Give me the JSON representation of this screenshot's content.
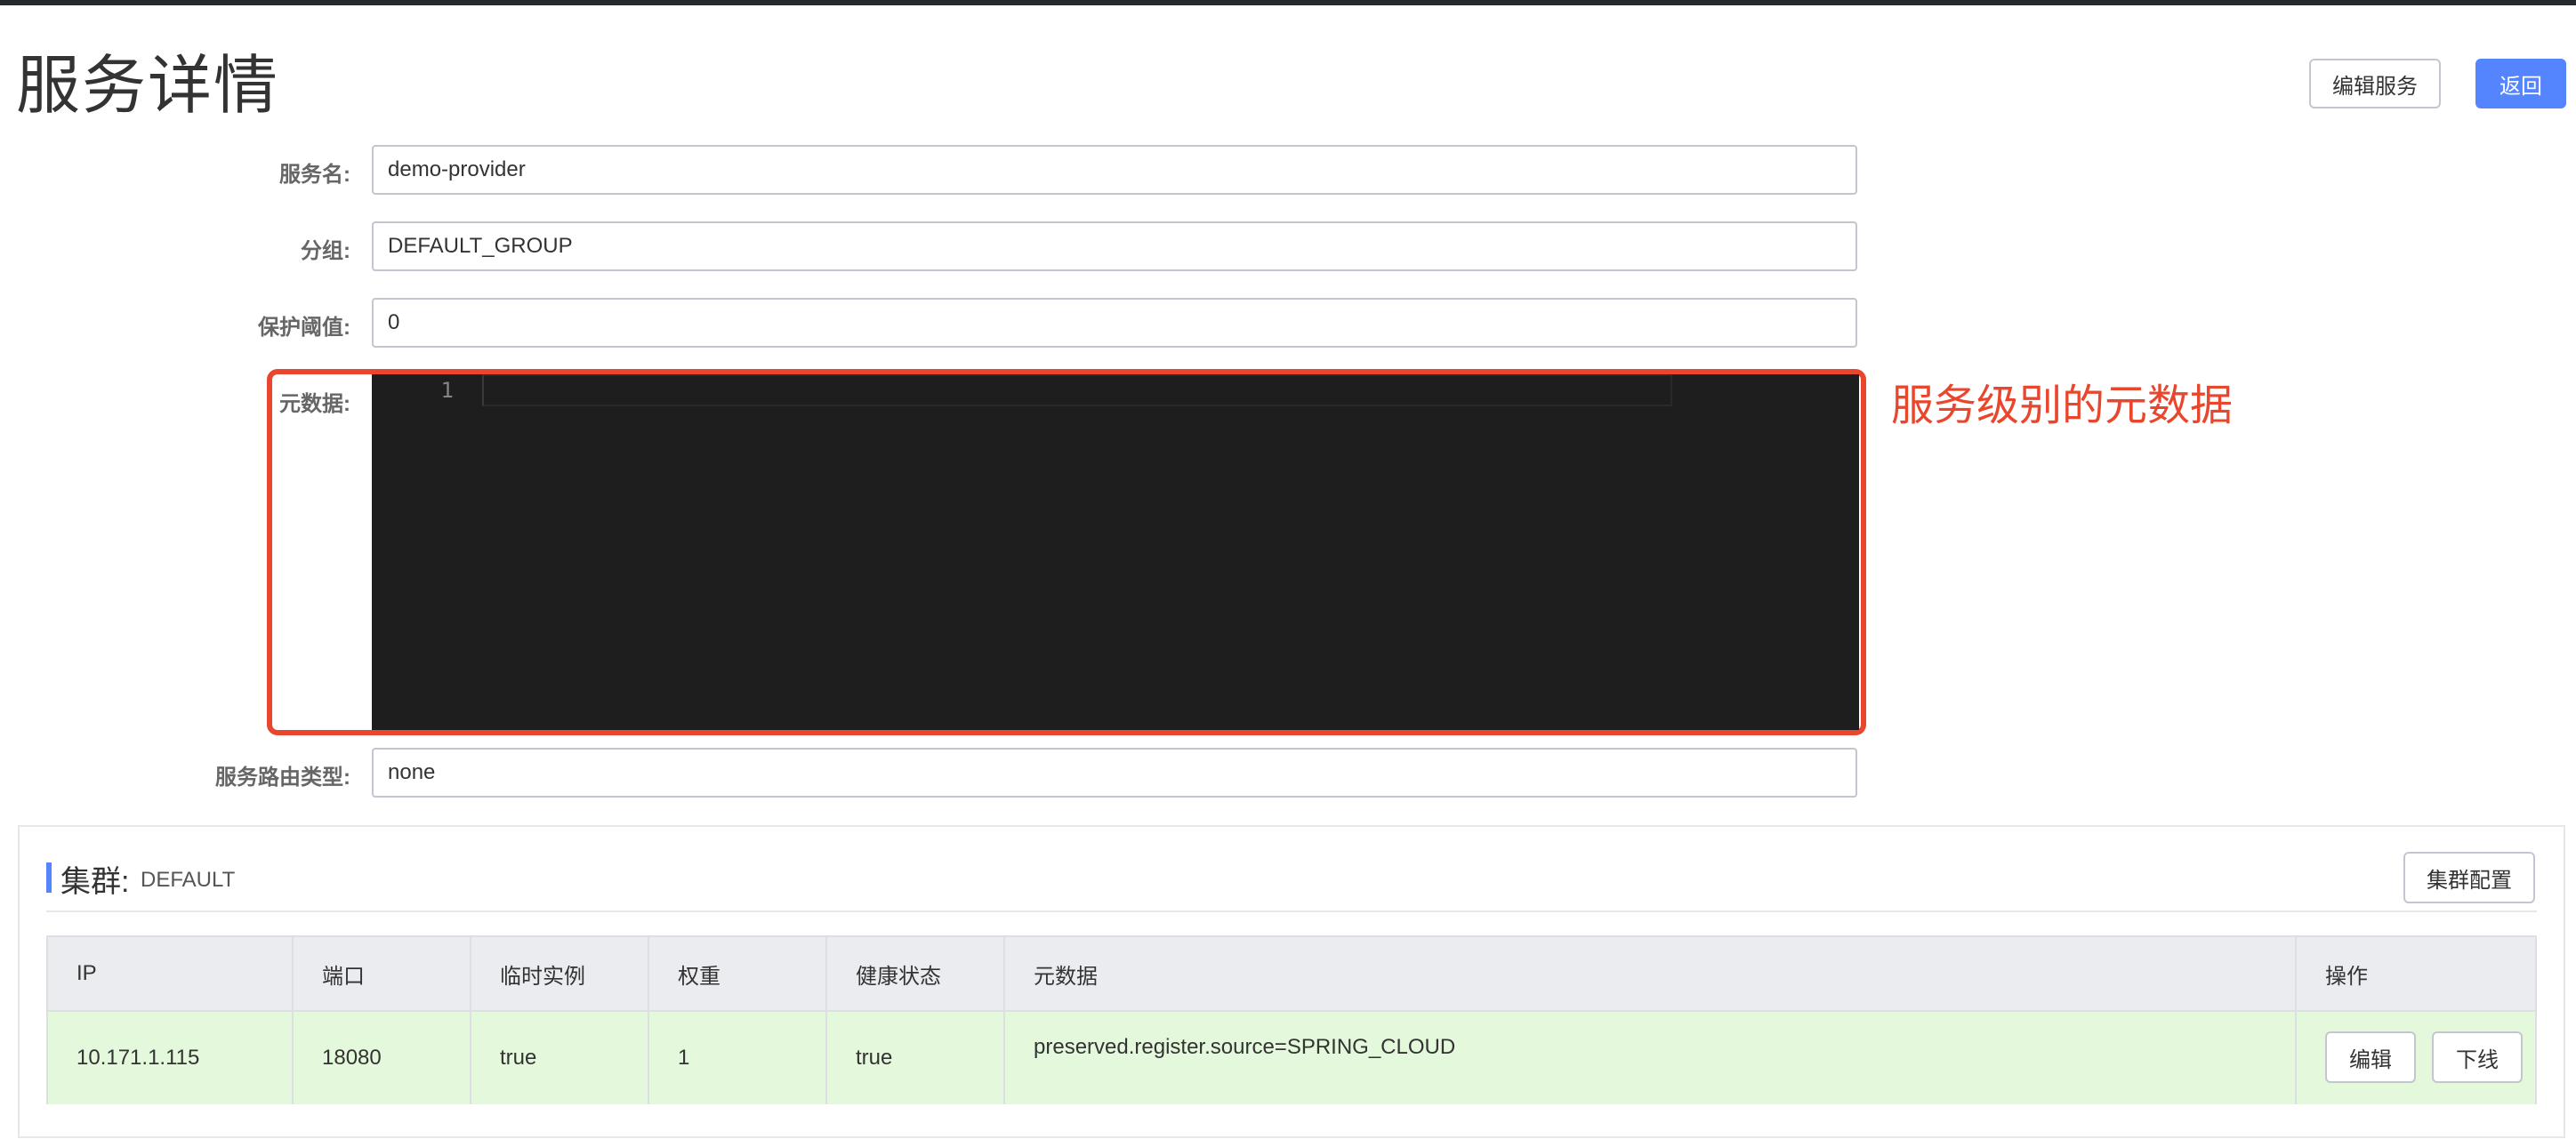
{
  "page": {
    "title": "服务详情",
    "edit_service_label": "编辑服务",
    "back_label": "返回"
  },
  "form": {
    "service_name": {
      "label": "服务名:",
      "value": "demo-provider"
    },
    "group": {
      "label": "分组:",
      "value": "DEFAULT_GROUP"
    },
    "protect_threshold": {
      "label": "保护阈值:",
      "value": "0"
    },
    "metadata": {
      "label": "元数据:",
      "line_number": "1"
    },
    "route_type": {
      "label": "服务路由类型:",
      "value": "none"
    }
  },
  "annotation": {
    "text": "服务级别的元数据",
    "color": "#e9462e"
  },
  "cluster": {
    "title": "集群:",
    "name": "DEFAULT",
    "config_label": "集群配置",
    "table": {
      "headers": [
        "IP",
        "端口",
        "临时实例",
        "权重",
        "健康状态",
        "元数据",
        "操作"
      ],
      "rows": [
        {
          "ip": "10.171.1.115",
          "port": "18080",
          "ephemeral": "true",
          "weight": "1",
          "healthy": "true",
          "metadata": "preserved.register.source=SPRING_CLOUD",
          "edit_label": "编辑",
          "offline_label": "下线"
        }
      ]
    }
  },
  "colors": {
    "primary": "#5584ff",
    "highlight": "#e9462e",
    "healthy_row": "#e4f8dc",
    "editor_bg": "#1e1e1e"
  }
}
